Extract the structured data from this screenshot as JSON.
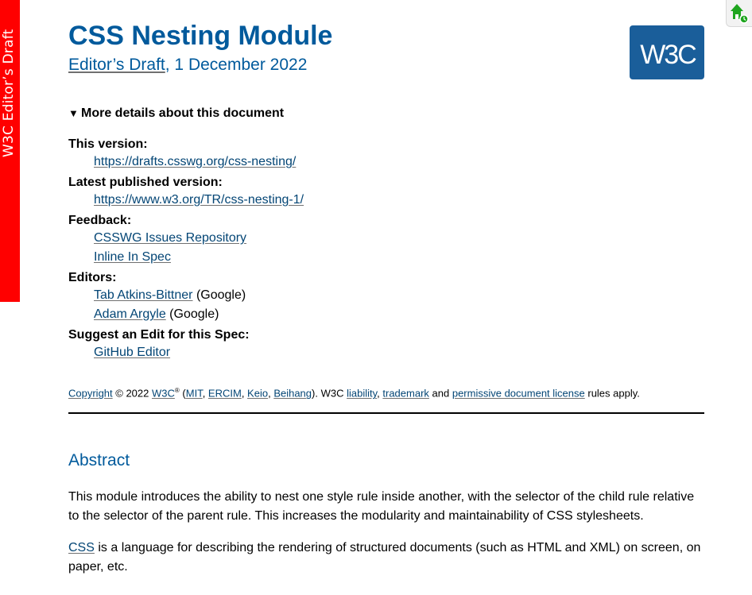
{
  "status_sticker": "W3C Editor’s Draft",
  "header": {
    "title": "CSS Nesting Module",
    "subtitle_link": "Editor’s Draft",
    "subtitle_date": ", 1 December 2022",
    "logo_text": "W3C"
  },
  "details": {
    "summary": "More details about this document",
    "this_version_label": "This version:",
    "this_version_url": "https://drafts.csswg.org/css-nesting/",
    "latest_label": "Latest published version:",
    "latest_url": "https://www.w3.org/TR/css-nesting-1/",
    "feedback_label": "Feedback:",
    "feedback_link_1": "CSSWG Issues Repository",
    "feedback_link_2": "Inline In Spec",
    "editors_label": "Editors:",
    "editor_1_name": "Tab Atkins-Bittner",
    "editor_1_org": " (Google)",
    "editor_2_name": "Adam Argyle",
    "editor_2_org": " (Google)",
    "suggest_label": "Suggest an Edit for this Spec:",
    "suggest_link": "GitHub Editor"
  },
  "copyright": {
    "copyright_link": "Copyright",
    "year_text": " © 2022 ",
    "w3c_link": "W3C",
    "reg": "®",
    "open_paren": " (",
    "mit": "MIT",
    "sep1": ", ",
    "ercim": "ERCIM",
    "sep2": ", ",
    "keio": "Keio",
    "sep3": ", ",
    "beihang": "Beihang",
    "after_beihang": "). W3C ",
    "liability": "liability",
    "sep4": ", ",
    "trademark": "trademark",
    "and_text": " and ",
    "license": "permissive document license",
    "tail": " rules apply."
  },
  "abstract": {
    "heading": "Abstract",
    "para1": "This module introduces the ability to nest one style rule inside another, with the selector of the child rule relative to the selector of the parent rule. This increases the modularity and maintainability of CSS stylesheets.",
    "css_link": "CSS",
    "para2_rest": " is a language for describing the rendering of structured documents (such as HTML and XML) on screen, on paper, etc."
  },
  "icons": {
    "home": "home-icon",
    "disclosure": "triangle-down-icon"
  },
  "colors": {
    "accent": "#005a9c",
    "link": "#034575",
    "sticker": "#ff0000",
    "logo_bg": "#1a5e9a",
    "home_icon": "#1ea51e"
  }
}
